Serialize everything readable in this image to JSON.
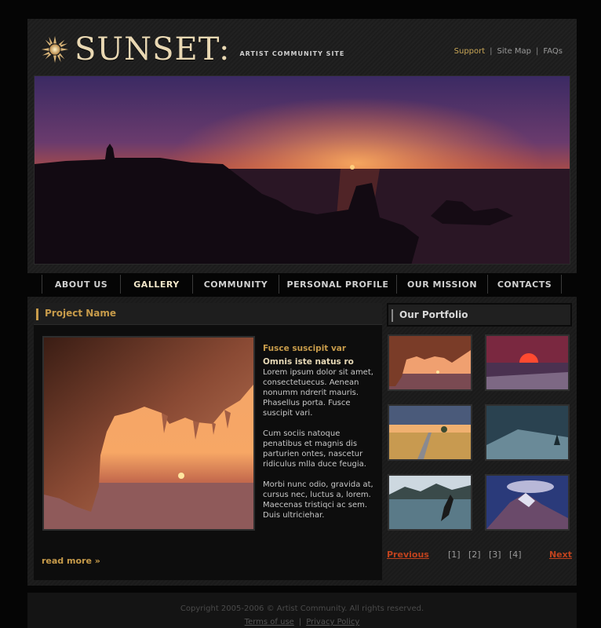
{
  "header": {
    "logo_text": "SUNSET:",
    "tagline": "ARTIST COMMUNITY SITE",
    "links": [
      {
        "label": "Support"
      },
      {
        "label": "Site Map"
      },
      {
        "label": "FAQs"
      }
    ]
  },
  "nav": {
    "items": [
      {
        "label": "ABOUT US"
      },
      {
        "label": "GALLERY"
      },
      {
        "label": "COMMUNITY"
      },
      {
        "label": "PERSONAL PROFILE"
      },
      {
        "label": "OUR MISSION"
      },
      {
        "label": "CONTACTS"
      }
    ]
  },
  "project": {
    "title": "Project Name",
    "heading1": "Fusce suscipit var",
    "heading2": "Omnis iste natus ro",
    "paragraphs": [
      "Lorem ipsum dolor sit amet, consectetuecus. Aenean nonumm ndrerit mauris. Phasellus porta. Fusce suscipit vari.",
      "Cum sociis natoque penatibus et magnis dis parturien ontes, nascetur ridiculus mlla duce feugia.",
      "Morbi nunc odio, gravida at, cursus nec, luctus a, lorem. Maecenas tristiqci ac sem. Duis ultriciehar."
    ],
    "read_more": "read more »"
  },
  "portfolio": {
    "title": "Our Portfolio",
    "previous": "Previous",
    "next": "Next",
    "pages": [
      "[1]",
      "[2]",
      "[3]",
      "[4]"
    ]
  },
  "footer": {
    "copyright": "Copyright 2005-2006 © Artist Community. All rights reserved.",
    "terms": "Terms of use",
    "privacy": "Privacy Policy"
  },
  "colors": {
    "accent": "#c79b4a",
    "link_red": "#c0421d",
    "background": "#050505"
  }
}
